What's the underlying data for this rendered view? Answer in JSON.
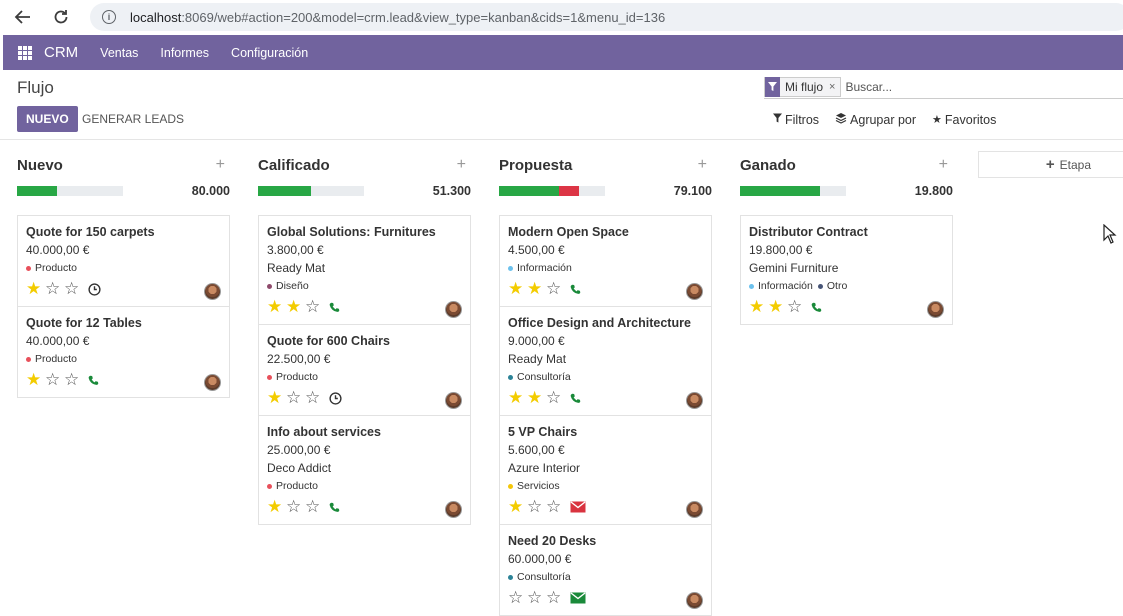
{
  "browser": {
    "url_host": "localhost",
    "url_rest": ":8069/web#action=200&model=crm.lead&view_type=kanban&cids=1&menu_id=136"
  },
  "nav": {
    "brand": "CRM",
    "items": [
      "Ventas",
      "Informes",
      "Configuración"
    ]
  },
  "control_panel": {
    "title": "Flujo",
    "new_label": "NUEVO",
    "generate_label": "GENERAR LEADS",
    "facet_label": "Mi flujo",
    "facet_close": "×",
    "search_placeholder": "Buscar...",
    "filters_label": "Filtros",
    "groupby_label": "Agrupar por",
    "favorites_label": "Favoritos"
  },
  "add_stage_label": "Etapa",
  "colors": {
    "brand": "#71639e",
    "green": "#28a745",
    "red": "#dc3545",
    "star": "#f3cc00"
  },
  "columns": [
    {
      "title": "Nuevo",
      "total": "80.000",
      "progress": {
        "green": 0.5,
        "red": 0
      },
      "cards": [
        {
          "title": "Quote for 150 carpets",
          "amount": "40.000,00 €",
          "company": "",
          "tags": [
            {
              "name": "Producto",
              "color": "#e8505b"
            }
          ],
          "stars": 1,
          "activity": "clock"
        },
        {
          "title": "Quote for 12 Tables",
          "amount": "40.000,00 €",
          "company": "",
          "tags": [
            {
              "name": "Producto",
              "color": "#e8505b"
            }
          ],
          "stars": 1,
          "activity": "phone"
        }
      ]
    },
    {
      "title": "Calificado",
      "total": "51.300",
      "progress": {
        "green": 0.67,
        "red": 0
      },
      "cards": [
        {
          "title": "Global Solutions: Furnitures",
          "amount": "3.800,00 €",
          "company": "Ready Mat",
          "tags": [
            {
              "name": "Diseño",
              "color": "#8e4a6b"
            }
          ],
          "stars": 2,
          "activity": "phone"
        },
        {
          "title": "Quote for 600 Chairs",
          "amount": "22.500,00 €",
          "company": "",
          "tags": [
            {
              "name": "Producto",
              "color": "#e8505b"
            }
          ],
          "stars": 1,
          "activity": "clock"
        },
        {
          "title": "Info about services",
          "amount": "25.000,00 €",
          "company": "Deco Addict",
          "tags": [
            {
              "name": "Producto",
              "color": "#e8505b"
            }
          ],
          "stars": 1,
          "activity": "phone"
        }
      ]
    },
    {
      "title": "Propuesta",
      "total": "79.100",
      "progress": {
        "green": 0.75,
        "red": 0.25
      },
      "cards": [
        {
          "title": "Modern Open Space",
          "amount": "4.500,00 €",
          "company": "",
          "tags": [
            {
              "name": "Información",
              "color": "#6cc1ed"
            }
          ],
          "stars": 2,
          "activity": "phone"
        },
        {
          "title": "Office Design and Architecture",
          "amount": "9.000,00 €",
          "company": "Ready Mat",
          "tags": [
            {
              "name": "Consultoría",
              "color": "#2c8397"
            }
          ],
          "stars": 2,
          "activity": "phone"
        },
        {
          "title": "5 VP Chairs",
          "amount": "5.600,00 €",
          "company": "Azure Interior",
          "tags": [
            {
              "name": "Servicios",
              "color": "#f4c609"
            }
          ],
          "stars": 1,
          "activity": "email-red"
        },
        {
          "title": "Need 20 Desks",
          "amount": "60.000,00 €",
          "company": "",
          "tags": [
            {
              "name": "Consultoría",
              "color": "#2c8397"
            }
          ],
          "stars": 0,
          "activity": "email-green"
        }
      ]
    },
    {
      "title": "Ganado",
      "total": "19.800",
      "progress": {
        "green": 1.0,
        "red": 0
      },
      "cards": [
        {
          "title": "Distributor Contract",
          "amount": "19.800,00 €",
          "company": "Gemini Furniture",
          "tags": [
            {
              "name": "Información",
              "color": "#6cc1ed"
            },
            {
              "name": "Otro",
              "color": "#475577"
            }
          ],
          "stars": 2,
          "activity": "phone"
        }
      ]
    }
  ]
}
